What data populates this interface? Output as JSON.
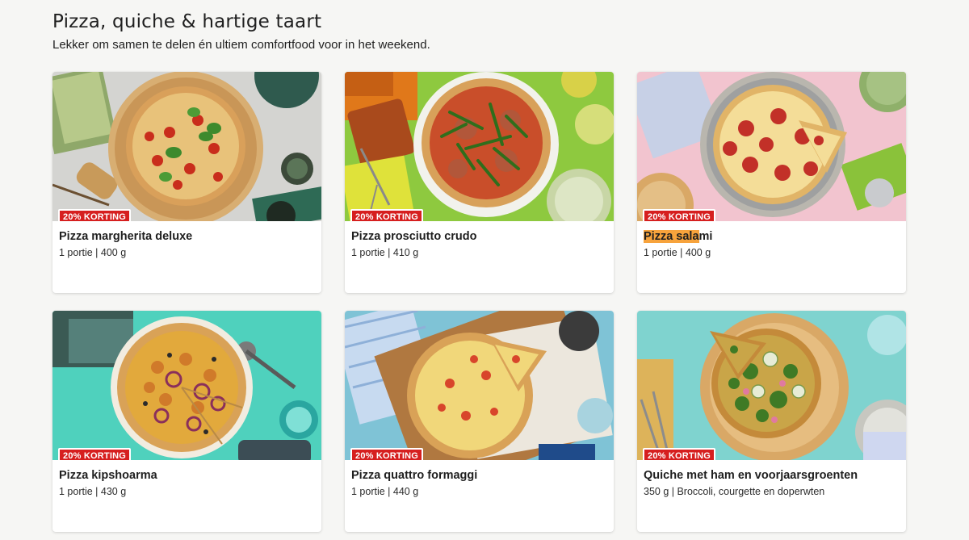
{
  "section": {
    "title": "Pizza, quiche & hartige taart",
    "subtitle": "Lekker om samen te delen én ultiem comfortfood voor in het weekend."
  },
  "cards": [
    {
      "badge": "20% KORTING",
      "title": "Pizza margherita deluxe",
      "meta": "1 portie | 400 g"
    },
    {
      "badge": "20% KORTING",
      "title": "Pizza prosciutto crudo",
      "meta": "1 portie | 410 g"
    },
    {
      "badge": "20% KORTING",
      "title_highlight": "Pizza sala",
      "title_rest": "mi",
      "meta": "1 portie | 400 g"
    },
    {
      "badge": "20% KORTING",
      "title": "Pizza kipshoarma",
      "meta": "1 portie | 430 g"
    },
    {
      "badge": "20% KORTING",
      "title": "Pizza quattro formaggi",
      "meta": "1 portie | 440 g"
    },
    {
      "badge": "20% KORTING",
      "title": "Quiche met ham en voorjaarsgroenten",
      "meta": "350 g | Broccoli, courgette en doperwten"
    }
  ],
  "colors": {
    "badge": "#d61f1f",
    "highlight": "#f7a33c"
  }
}
